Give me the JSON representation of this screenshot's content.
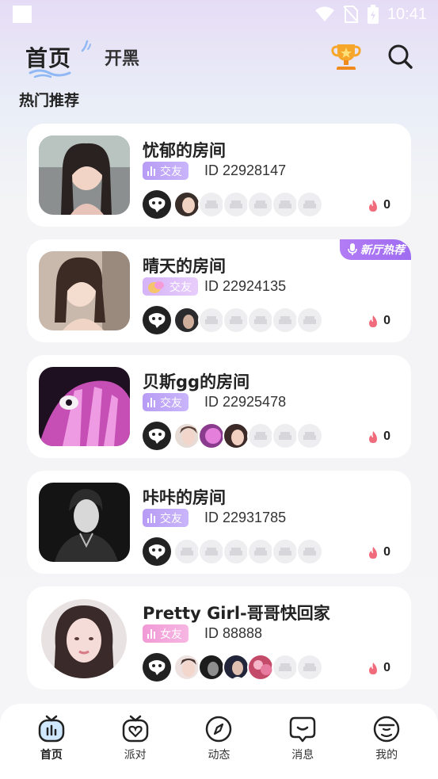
{
  "status_bar": {
    "time": "10:41"
  },
  "header": {
    "tab_home": "首页",
    "tab_open": "开黑"
  },
  "section_title": "热门推荐",
  "rooms": [
    {
      "name": "忧郁的房间",
      "tag": "交友",
      "id_text": "ID 22928147",
      "heat": "0"
    },
    {
      "name": "晴天的房间",
      "tag": "交友",
      "id_text": "ID 22924135",
      "heat": "0",
      "badge": "新厅热荐"
    },
    {
      "name": "贝斯gg的房间",
      "tag": "交友",
      "id_text": "ID 22925478",
      "heat": "0"
    },
    {
      "name": "咔咔的房间",
      "tag": "交友",
      "id_text": "ID 22931785",
      "heat": "0"
    },
    {
      "name": "Pretty Girl-哥哥快回家",
      "tag": "女友",
      "id_text": "ID 88888",
      "heat": "0"
    }
  ],
  "nav": [
    {
      "label": "首页",
      "icon": "home-tv-icon",
      "active": true
    },
    {
      "label": "派对",
      "icon": "party-tv-heart-icon"
    },
    {
      "label": "动态",
      "icon": "compass-icon"
    },
    {
      "label": "消息",
      "icon": "message-bubble-icon"
    },
    {
      "label": "我的",
      "icon": "profile-face-icon"
    }
  ],
  "colors": {
    "accent_purple": "#b89cf5",
    "accent_pink": "#f19ad6",
    "badge_purple": "#a56ff1"
  }
}
